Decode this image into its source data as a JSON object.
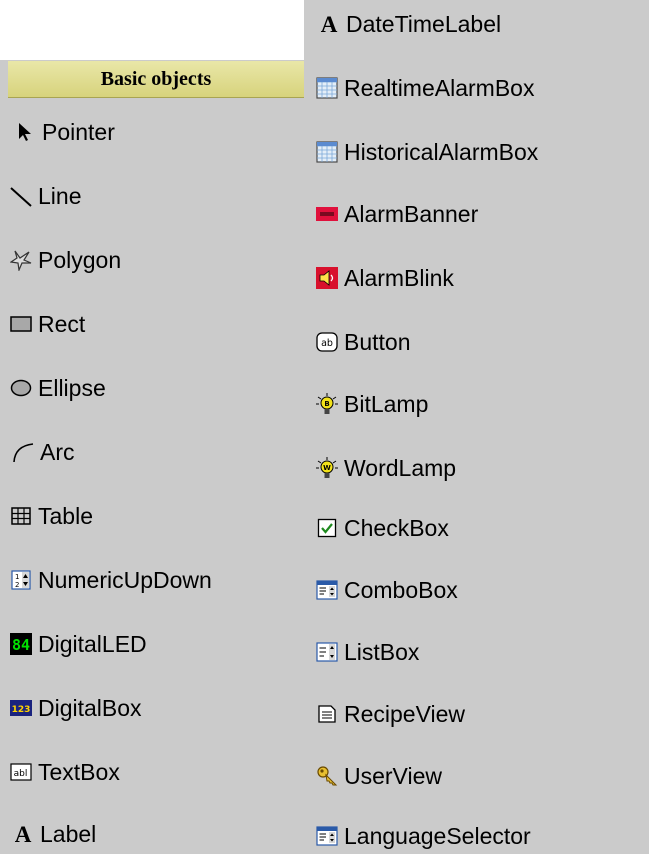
{
  "header": {
    "title": "Basic objects"
  },
  "left_items": [
    {
      "label": "Pointer",
      "icon": "pointer-icon"
    },
    {
      "label": "Line",
      "icon": "line-icon"
    },
    {
      "label": "Polygon",
      "icon": "polygon-icon"
    },
    {
      "label": "Rect",
      "icon": "rect-icon"
    },
    {
      "label": "Ellipse",
      "icon": "ellipse-icon"
    },
    {
      "label": "Arc",
      "icon": "arc-icon"
    },
    {
      "label": "Table",
      "icon": "table-icon"
    },
    {
      "label": "NumericUpDown",
      "icon": "numeric-updown-icon"
    },
    {
      "label": "DigitalLED",
      "icon": "digital-led-icon"
    },
    {
      "label": "DigitalBox",
      "icon": "digital-box-icon"
    },
    {
      "label": "TextBox",
      "icon": "textbox-icon"
    },
    {
      "label": "Label",
      "icon": "label-icon"
    }
  ],
  "right_items": [
    {
      "label": "DateTimeLabel",
      "icon": "datetime-label-icon"
    },
    {
      "label": "RealtimeAlarmBox",
      "icon": "realtime-alarm-box-icon"
    },
    {
      "label": "HistoricalAlarmBox",
      "icon": "historical-alarm-box-icon"
    },
    {
      "label": "AlarmBanner",
      "icon": "alarm-banner-icon"
    },
    {
      "label": "AlarmBlink",
      "icon": "alarm-blink-icon"
    },
    {
      "label": "Button",
      "icon": "button-icon"
    },
    {
      "label": "BitLamp",
      "icon": "bit-lamp-icon"
    },
    {
      "label": "WordLamp",
      "icon": "word-lamp-icon"
    },
    {
      "label": "CheckBox",
      "icon": "checkbox-icon"
    },
    {
      "label": "ComboBox",
      "icon": "combobox-icon"
    },
    {
      "label": "ListBox",
      "icon": "listbox-icon"
    },
    {
      "label": "RecipeView",
      "icon": "recipe-view-icon"
    },
    {
      "label": "UserView",
      "icon": "user-view-icon"
    },
    {
      "label": "LanguageSelector",
      "icon": "language-selector-icon"
    }
  ],
  "icon_glyphs": {
    "label_letter": "A",
    "digital_led_text": "84",
    "digital_box_text": "123",
    "textbox_text": "abl",
    "button_text": "ab"
  },
  "colors": {
    "panel": "#cbcbcb",
    "header_top": "#e9e7a8",
    "header_bottom": "#d7d37c",
    "alarm_red": "#e0103c",
    "led_green": "#00e000",
    "lamp_yellow": "#f2e21a",
    "check_green": "#1f8a1f"
  }
}
